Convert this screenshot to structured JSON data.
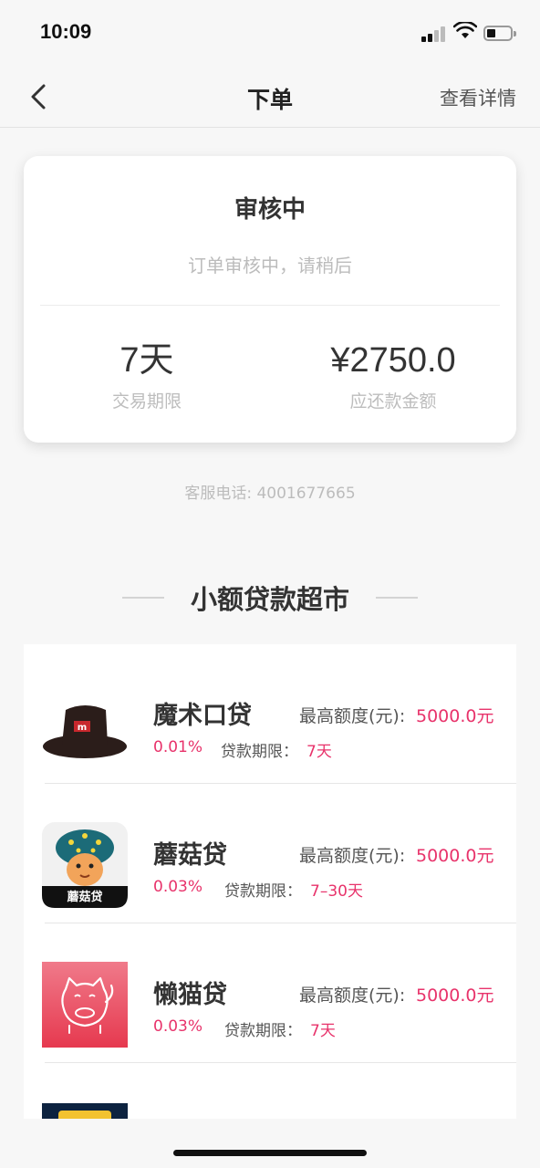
{
  "status_bar": {
    "time": "10:09"
  },
  "nav": {
    "title": "下单",
    "right_action": "查看详情"
  },
  "order_status": {
    "title": "审核中",
    "subtitle": "订单审核中，请稍后",
    "term_value": "7天",
    "term_label": "交易期限",
    "amount_value": "¥2750.0",
    "amount_label": "应还款金额"
  },
  "service_phone": "客服电话: 4001677665",
  "market": {
    "title": "小额贷款超市",
    "items": [
      {
        "name": "魔术口贷",
        "limit_label": "最高额度(元):",
        "limit_value": "5000.0元",
        "rate": "0.01%",
        "term_label": "贷款期限：",
        "term_value": "7天",
        "logo": "magic-hat-icon"
      },
      {
        "name": "蘑菇贷",
        "limit_label": "最高额度(元):",
        "limit_value": "5000.0元",
        "rate": "0.03%",
        "term_label": "贷款期限：",
        "term_value": "7–30天",
        "logo": "mushroom-icon",
        "logo_text": "蘑菇贷"
      },
      {
        "name": "懒猫贷",
        "limit_label": "最高额度(元):",
        "limit_value": "5000.0元",
        "rate": "0.03%",
        "term_label": "贷款期限：",
        "term_value": "7天",
        "logo": "lucky-cat-icon"
      }
    ]
  },
  "colors": {
    "accent": "#e8336b",
    "background": "#f7f7f7",
    "card": "#ffffff"
  }
}
